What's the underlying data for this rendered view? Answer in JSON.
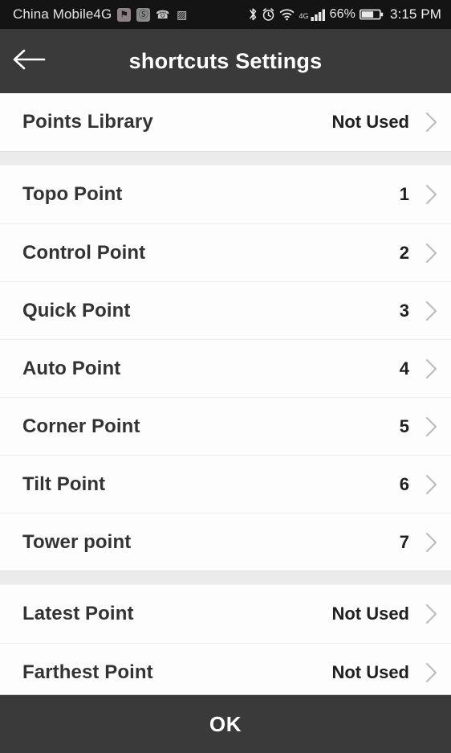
{
  "status_bar": {
    "carrier": "China Mobile4G",
    "tray_icons": [
      {
        "name": "notification-app-icon-1",
        "glyph": "⚑"
      },
      {
        "name": "notification-app-icon-2",
        "glyph": "Ⓢ"
      },
      {
        "name": "notification-app-icon-3",
        "glyph": "☎"
      },
      {
        "name": "notification-app-icon-4",
        "glyph": "▨"
      }
    ],
    "bluetooth_icon": "bluetooth-icon",
    "alarm_icon": "alarm-clock-icon",
    "wifi_icon": "wifi-icon",
    "network_type": "4G",
    "signal_icon": "signal-bars-icon",
    "battery_percent": "66%",
    "battery_icon": "battery-icon",
    "clock": "3:15 PM"
  },
  "app_bar": {
    "back_icon": "back-arrow-icon",
    "title": "shortcuts Settings"
  },
  "list": {
    "groups": [
      {
        "rows": [
          {
            "label": "Points Library",
            "value": "Not Used"
          }
        ]
      },
      {
        "rows": [
          {
            "label": "Topo Point",
            "value": "1"
          },
          {
            "label": "Control Point",
            "value": "2"
          },
          {
            "label": "Quick Point",
            "value": "3"
          },
          {
            "label": "Auto Point",
            "value": "4"
          },
          {
            "label": "Corner Point",
            "value": "5"
          },
          {
            "label": "Tilt Point",
            "value": "6"
          },
          {
            "label": "Tower point",
            "value": "7"
          }
        ]
      },
      {
        "rows": [
          {
            "label": "Latest Point",
            "value": "Not Used"
          },
          {
            "label": "Farthest Point",
            "value": "Not Used"
          }
        ]
      }
    ]
  },
  "footer": {
    "ok_label": "OK"
  },
  "colors": {
    "app_bar": "#3a3a3a",
    "status_bar": "#141414",
    "page_bg": "#fdfdfd",
    "group_gap": "#ebebeb",
    "label_text": "#333333",
    "chevron": "#bcbcbc"
  }
}
